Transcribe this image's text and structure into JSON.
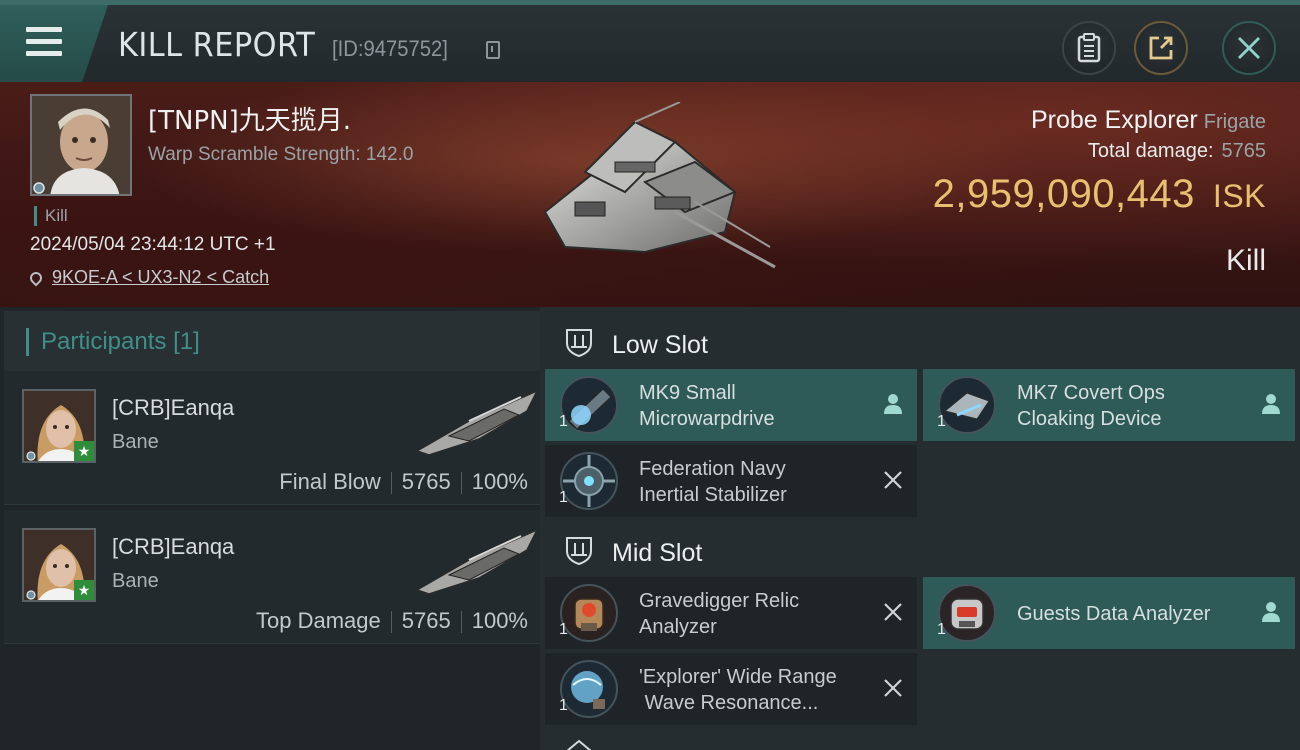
{
  "header": {
    "title": "KILL REPORT",
    "report_id": "[ID:9475752]",
    "icons": [
      "menu-icon",
      "copy-icon",
      "clipboard-icon",
      "share-icon",
      "close-icon"
    ]
  },
  "victim": {
    "name": "[TNPN]九天揽月.",
    "warp_strength": "Warp Scramble Strength: 142.0",
    "tag": "Kill",
    "datetime": "2024/05/04 23:44:12 UTC +1",
    "location": "9KOE-A < UX3-N2 < Catch",
    "ship_name": "Probe Explorer",
    "ship_class": "Frigate",
    "total_damage_label": "Total damage:",
    "total_damage": "5765",
    "isk_value": "2,959,090,443",
    "isk_unit": "ISK",
    "kill_type": "Kill"
  },
  "participants": {
    "label": "Participants",
    "count": "[1]",
    "rows": [
      {
        "name": "[CRB]Eanqa",
        "ship": "Bane",
        "role": "Final Blow",
        "damage": "5765",
        "percent": "100%"
      },
      {
        "name": "[CRB]Eanqa",
        "ship": "Bane",
        "role": "Top Damage",
        "damage": "5765",
        "percent": "100%"
      }
    ]
  },
  "fitting": {
    "low_slot": {
      "label": "Low Slot",
      "modules": [
        {
          "name_l1": "MK9 Small",
          "name_l2": "Microwarpdrive",
          "qty": "1",
          "state": "dropped"
        },
        {
          "name_l1": "MK7 Covert Ops",
          "name_l2": "Cloaking Device",
          "qty": "1",
          "state": "dropped"
        },
        {
          "name_l1": "Federation Navy",
          "name_l2": "Inertial Stabilizer",
          "qty": "1",
          "state": "destroyed"
        }
      ]
    },
    "mid_slot": {
      "label": "Mid Slot",
      "modules": [
        {
          "name_l1": "Gravedigger Relic",
          "name_l2": "Analyzer",
          "qty": "1",
          "state": "destroyed"
        },
        {
          "name_l1": "Guests Data Analyzer",
          "name_l2": "",
          "qty": "1",
          "state": "dropped"
        },
        {
          "name_l1": "'Explorer' Wide Range",
          "name_l2": "Wave Resonance...",
          "qty": "1",
          "state": "destroyed"
        }
      ]
    }
  },
  "colors": {
    "accent": "#3f8f88",
    "isk": "#e8c070",
    "dropped_bg": "#2e5a57",
    "destroyed_bg": "#1e2427"
  }
}
